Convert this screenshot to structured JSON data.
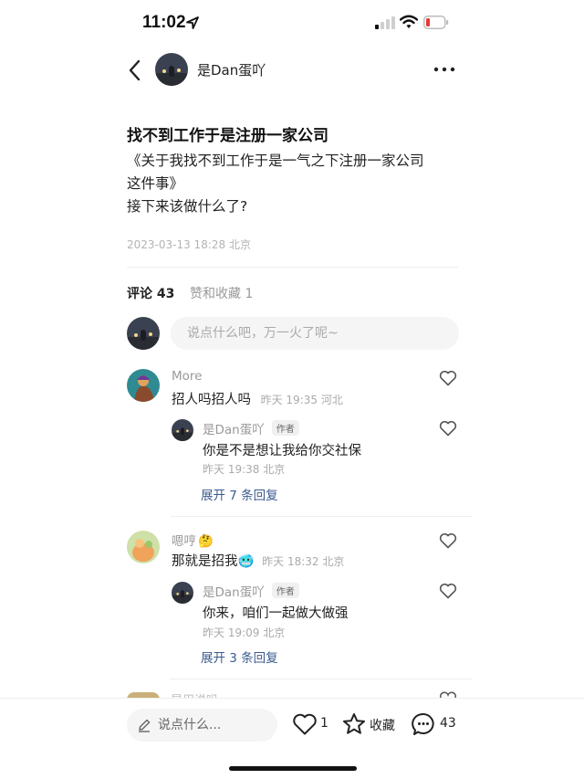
{
  "status_bar": {
    "time": "11:02"
  },
  "header": {
    "author_name": "是Dan蛋吖"
  },
  "post": {
    "title": "找不到工作于是注册一家公司",
    "body_lines": [
      "《关于我找不到工作于是一气之下注册一家公司",
      "这件事》",
      "接下来该做什么了?"
    ],
    "meta": "2023-03-13 18:28 北京"
  },
  "tabs": {
    "comments": "评论 43",
    "likes": "赞和收藏 1"
  },
  "comment_input": {
    "placeholder": "说点什么吧，万一火了呢~"
  },
  "comments": [
    {
      "name": "More",
      "text": "招人吗招人吗",
      "meta": "昨天 19:35 河北",
      "reply": {
        "name": "是Dan蛋吖",
        "badge": "作者",
        "text": "你是不是想让我给你交社保",
        "meta": "昨天 19:38 北京"
      },
      "expand": "展开 7 条回复"
    },
    {
      "name": "嗯哼",
      "name_emoji": "🤔",
      "text": "那就是招我",
      "text_emoji": "🥶",
      "meta": "昨天 18:32 北京",
      "reply": {
        "name": "是Dan蛋吖",
        "badge": "作者",
        "text": "你来，咱们一起做大做强",
        "meta": "昨天 19:09 北京"
      },
      "expand": "展开 3 条回复"
    }
  ],
  "peek_comment": {
    "name": "是用说吗"
  },
  "bottom_bar": {
    "input_label": "说点什么...",
    "like_count": "1",
    "favorite_label": "收藏",
    "comment_count": "43"
  },
  "colors": {
    "link": "#3b5b8f",
    "battery_low": "#e53935",
    "muted": "#aaaaaa"
  }
}
